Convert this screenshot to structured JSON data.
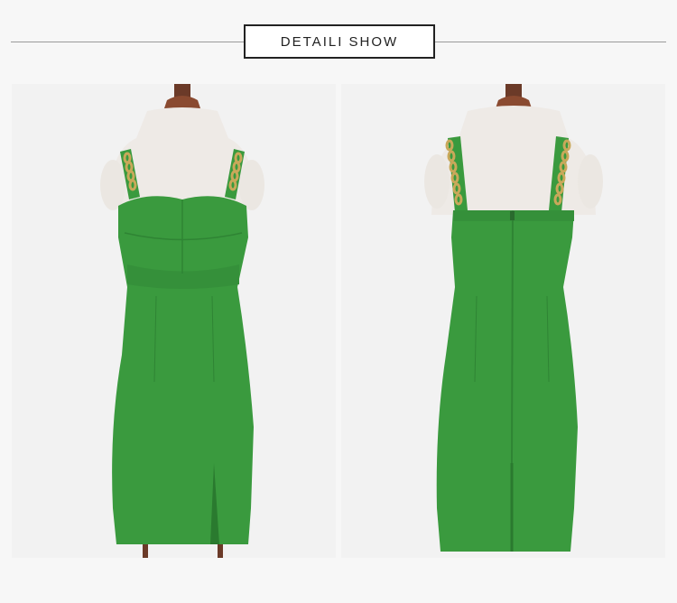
{
  "header": {
    "title": "DETAILI SHOW"
  },
  "images": [
    {
      "view": "front",
      "description_icon": "green-dress-front-photo"
    },
    {
      "view": "back",
      "description_icon": "green-dress-back-photo"
    }
  ],
  "colors": {
    "background": "#f7f7f7",
    "panel": "#f2f2f2",
    "dress": "#3a9a3e",
    "chain": "#c9a85a",
    "mannequin": "#ede9e4",
    "stand_cap": "#8a4a30",
    "rule": "#9a9a9a",
    "title_border": "#222222"
  }
}
